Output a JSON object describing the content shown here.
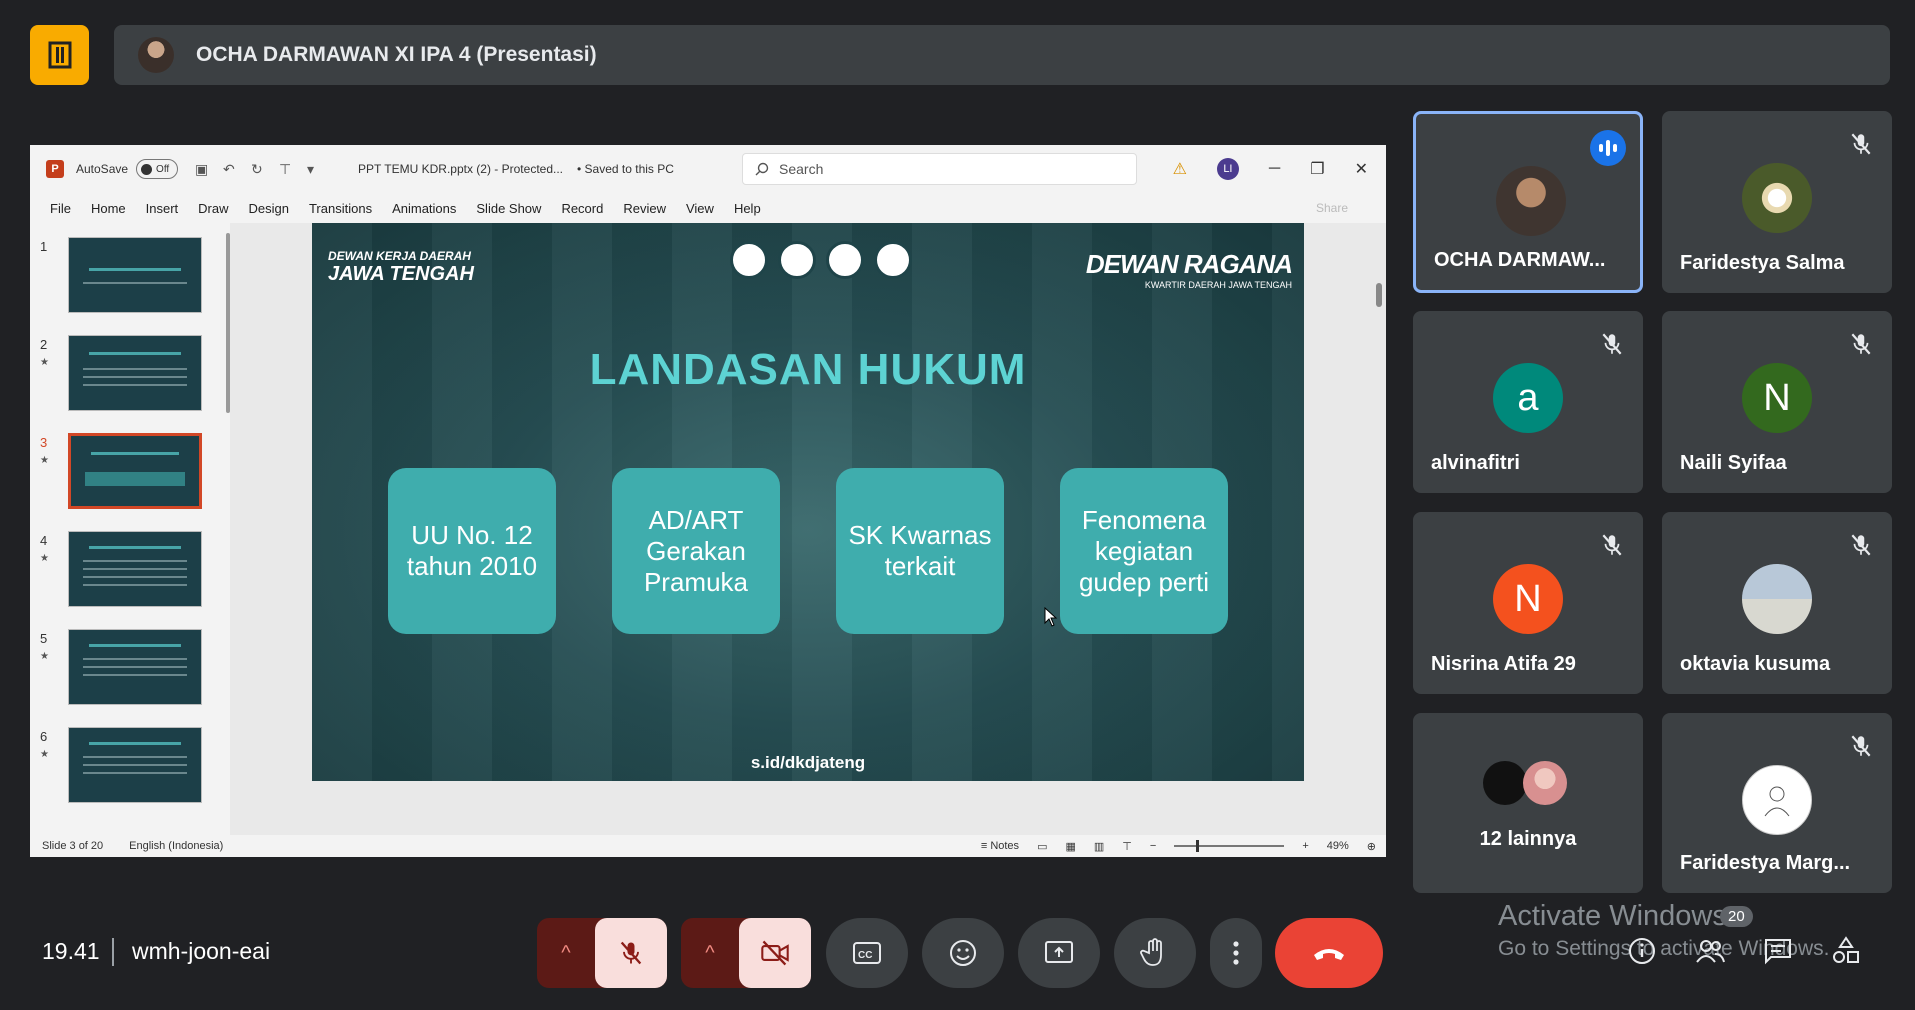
{
  "presenter": {
    "name": "OCHA DARMAWAN XI IPA 4 (Presentasi)"
  },
  "ppt": {
    "autosave_label": "AutoSave",
    "toggle_label": "Off",
    "file_name": "PPT TEMU KDR.pptx (2)  -  Protected...",
    "saved_label": "•  Saved to this PC",
    "search_placeholder": "Search",
    "user_initial": "LI",
    "tabs": [
      "File",
      "Home",
      "Insert",
      "Draw",
      "Design",
      "Transitions",
      "Animations",
      "Slide Show",
      "Record",
      "Review",
      "View",
      "Help"
    ],
    "share_label": "Share",
    "thumbnails": [
      {
        "num": "1",
        "star": ""
      },
      {
        "num": "2",
        "star": "★"
      },
      {
        "num": "3",
        "star": "★"
      },
      {
        "num": "4",
        "star": "★"
      },
      {
        "num": "5",
        "star": "★"
      },
      {
        "num": "6",
        "star": "★"
      }
    ],
    "status": {
      "slide": "Slide 3 of 20",
      "lang": "English (Indonesia)",
      "notes": "Notes",
      "zoom": "49%"
    }
  },
  "slide": {
    "brand_left_1": "DEWAN KERJA DAERAH",
    "brand_left_2": "JAWA TENGAH",
    "brand_right_1": "DEWAN RAGANA",
    "brand_right_2": "KWARTIR DAERAH JAWA TENGAH",
    "title": "LANDASAN HUKUM",
    "cards": [
      "UU No. 12 tahun 2010",
      "AD/ART Gerakan Pramuka",
      "SK Kwarnas terkait",
      "Fenomena kegiatan gudep perti"
    ],
    "footer": "s.id/dkdjateng"
  },
  "participants": [
    {
      "name": "OCHA DARMAW...",
      "color": "#555"
    },
    {
      "name": "Faridestya Salma",
      "color": "#4a5a2a"
    },
    {
      "name": "alvinafitri",
      "initial": "a",
      "color": "#00897b"
    },
    {
      "name": "Naili Syifaa",
      "initial": "N",
      "color": "#33691e"
    },
    {
      "name": "Nisrina Atifa 29",
      "initial": "N",
      "color": "#f4511e"
    },
    {
      "name": "oktavia kusuma",
      "color": "#8fa3b8"
    },
    {
      "name": "12 lainnya"
    },
    {
      "name": "Faridestya Marg...",
      "color": "#ffffff"
    }
  ],
  "meeting": {
    "time": "19.41",
    "code": "wmh-joon-eai",
    "participant_count": "20"
  },
  "watermark": {
    "line1": "Activate Windows",
    "line2": "Go to Settings to activate Windows."
  }
}
